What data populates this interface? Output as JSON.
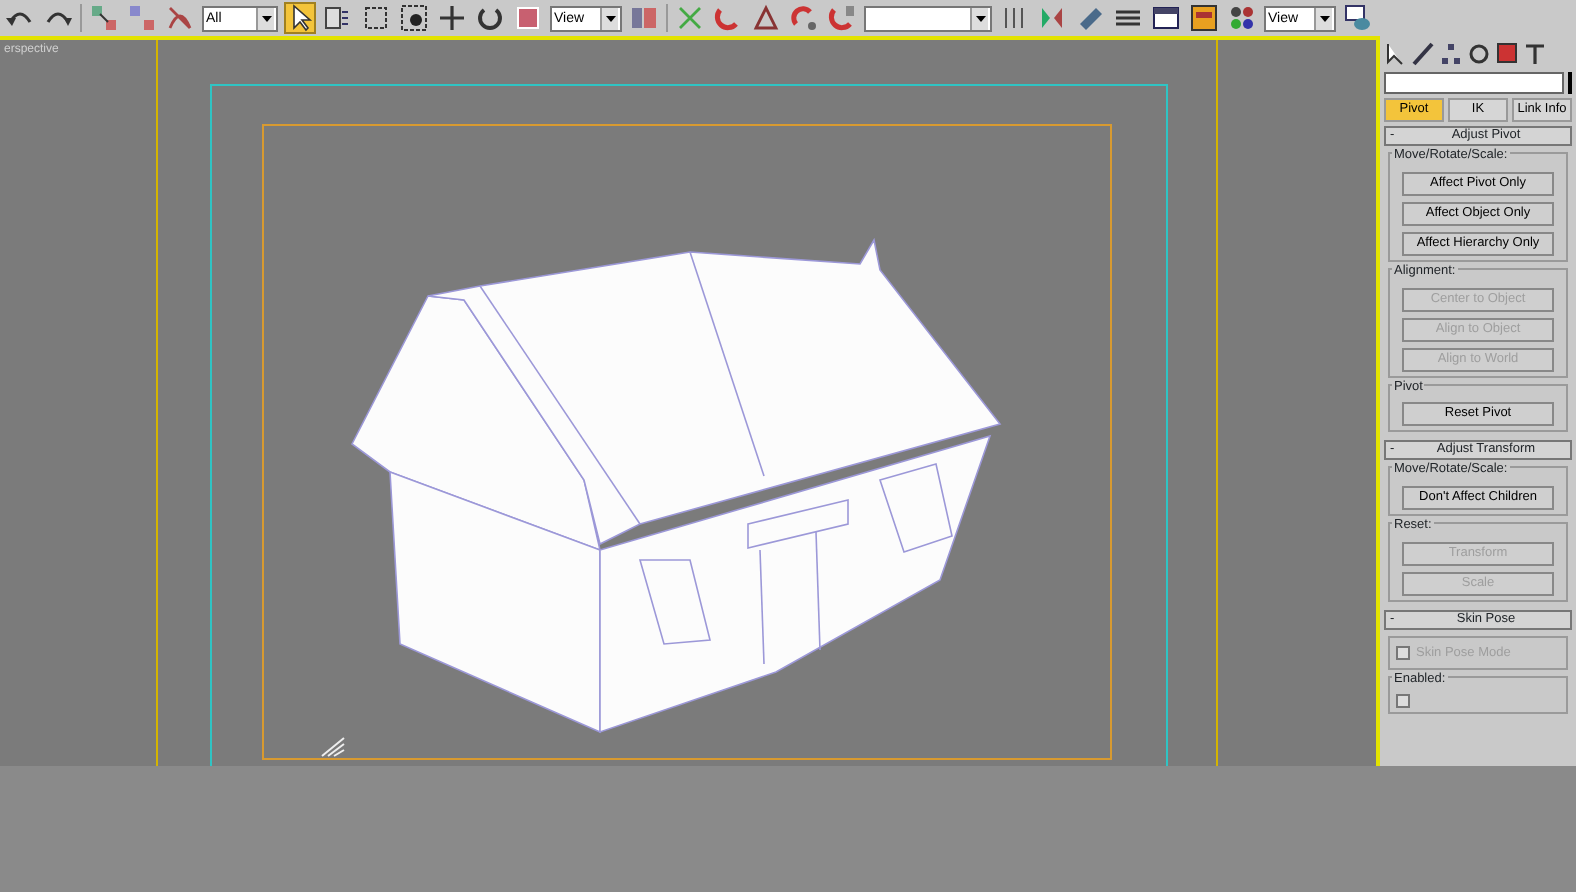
{
  "toolbar": [
    {
      "kind": "tool",
      "selected": false
    },
    {
      "kind": "tool",
      "selected": false
    },
    {
      "kind": "separator"
    },
    {
      "kind": "tool",
      "selected": false
    },
    {
      "kind": "tool",
      "selected": false
    },
    {
      "kind": "tool",
      "selected": false
    },
    {
      "kind": "dropdown",
      "value": "All"
    },
    {
      "kind": "tool",
      "selected": true
    },
    {
      "kind": "tool",
      "selected": false
    },
    {
      "kind": "tool",
      "selected": false
    },
    {
      "kind": "tool",
      "selected": false
    },
    {
      "kind": "tool",
      "selected": false
    },
    {
      "kind": "tool",
      "selected": false
    },
    {
      "kind": "tool",
      "selected": false
    },
    {
      "kind": "dropdown",
      "value": "View"
    },
    {
      "kind": "tool",
      "selected": false
    },
    {
      "kind": "separator"
    },
    {
      "kind": "tool",
      "selected": false
    },
    {
      "kind": "tool",
      "selected": false
    },
    {
      "kind": "tool",
      "selected": false
    },
    {
      "kind": "tool",
      "selected": false
    },
    {
      "kind": "tool",
      "selected": false
    },
    {
      "kind": "dropdown"
    },
    {
      "kind": "tool",
      "selected": false
    },
    {
      "kind": "tool",
      "selected": false
    },
    {
      "kind": "tool",
      "selected": false
    },
    {
      "kind": "tool",
      "selected": false
    },
    {
      "kind": "tool",
      "selected": false
    },
    {
      "kind": "tool",
      "selected": false
    },
    {
      "kind": "tool",
      "selected": false
    },
    {
      "kind": "dropdown",
      "value": "View"
    },
    {
      "kind": "tool",
      "selected": false
    }
  ],
  "viewport": {
    "label": "erspective"
  },
  "command_panel": {
    "tabs": [
      {
        "label": "Pivot",
        "selected": true
      },
      {
        "label": "IK",
        "selected": false
      },
      {
        "label": "Link Info",
        "selected": false
      }
    ],
    "rollouts": [
      {
        "sign": "-",
        "title": "Adjust Pivot",
        "groups": [
          {
            "title": "Move/Rotate/Scale:",
            "items": [
              {
                "kind": "button",
                "label": "Affect Pivot Only",
                "disabled": false
              },
              {
                "kind": "button",
                "label": "Affect Object Only",
                "disabled": false
              },
              {
                "kind": "button",
                "label": "Affect Hierarchy Only",
                "disabled": false
              }
            ]
          },
          {
            "title": "Alignment:",
            "items": [
              {
                "kind": "button",
                "label": "Center to Object",
                "disabled": true
              },
              {
                "kind": "button",
                "label": "Align to Object",
                "disabled": true
              },
              {
                "kind": "button",
                "label": "Align to World",
                "disabled": true
              }
            ]
          },
          {
            "title": "Pivot",
            "items": [
              {
                "kind": "button",
                "label": "Reset Pivot",
                "disabled": false
              }
            ]
          }
        ]
      },
      {
        "sign": "-",
        "title": "Adjust Transform",
        "groups": [
          {
            "title": "Move/Rotate/Scale:",
            "items": [
              {
                "kind": "button",
                "label": "Don't Affect Children",
                "disabled": false
              }
            ]
          },
          {
            "title": "Reset:",
            "items": [
              {
                "kind": "button",
                "label": "Transform",
                "disabled": true
              },
              {
                "kind": "button",
                "label": "Scale",
                "disabled": true
              }
            ]
          }
        ]
      },
      {
        "sign": "-",
        "title": "Skin Pose",
        "groups": [
          {
            "items": [
              {
                "kind": "checkbox",
                "label": "Skin Pose Mode",
                "checked": false,
                "disabled": true
              }
            ]
          },
          {
            "title": "Enabled:",
            "items": [
              {
                "kind": "checkbox",
                "checked": false,
                "disabled": true
              }
            ]
          }
        ]
      }
    ]
  }
}
